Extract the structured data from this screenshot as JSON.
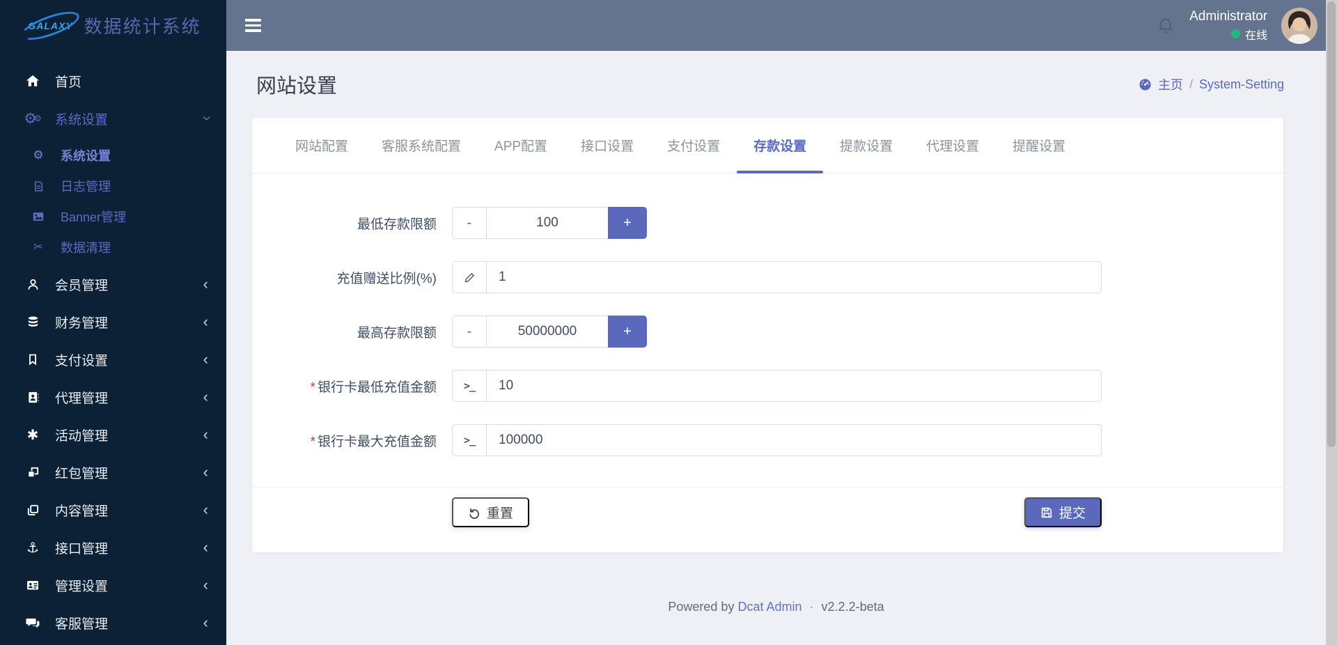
{
  "app": {
    "logo": "GALAXY",
    "name": "数据统计系统"
  },
  "topbar": {
    "user": "Administrator",
    "status": "在线"
  },
  "sidebar": {
    "home": "首页",
    "system_parent": "系统设置",
    "system_sub": "系统设置",
    "logs": "日志管理",
    "banner": "Banner管理",
    "data_clean": "数据清理",
    "members": "会员管理",
    "finance": "财务管理",
    "payment": "支付设置",
    "agent": "代理管理",
    "activity": "活动管理",
    "red_packet": "红包管理",
    "content": "内容管理",
    "api": "接口管理",
    "admin": "管理设置",
    "service": "客服管理"
  },
  "page": {
    "title": "网站设置",
    "breadcrumb_home": "主页",
    "breadcrumb_sep": "/",
    "breadcrumb_current": "System-Setting"
  },
  "tabs": {
    "t0": "网站配置",
    "t1": "客服系统配置",
    "t2": "APP配置",
    "t3": "接口设置",
    "t4": "支付设置",
    "t5": "存款设置",
    "t6": "提款设置",
    "t7": "代理设置",
    "t8": "提醒设置",
    "active_tab": "存款设置"
  },
  "form": {
    "f1": {
      "label": "最低存款限额",
      "value": "100"
    },
    "f2": {
      "label": "充值赠送比例(%)",
      "value": "1"
    },
    "f3": {
      "label": "最高存款限额",
      "value": "50000000"
    },
    "f4": {
      "label": "银行卡最低充值金额",
      "value": "10",
      "required_mark": "*"
    },
    "f5": {
      "label": "银行卡最大充值金额",
      "value": "100000",
      "required_mark": "*"
    },
    "reset_label": "重置",
    "submit_label": "提交"
  },
  "footer": {
    "powered": "Powered by",
    "brand": "Dcat Admin",
    "sep": "·",
    "version": "v2.2.2-beta"
  },
  "icons": {
    "gear": "⚙",
    "scissors": "✂",
    "anchor": "⚓",
    "asterisk": "✱",
    "chevron": "‹",
    "minus": "-",
    "plus": "+",
    "terminal": ">_"
  },
  "colors": {
    "primary": "#5b69bd",
    "sidebar_bg": "#0c2135",
    "topbar_bg": "#64748f",
    "online_green": "#21b978"
  }
}
